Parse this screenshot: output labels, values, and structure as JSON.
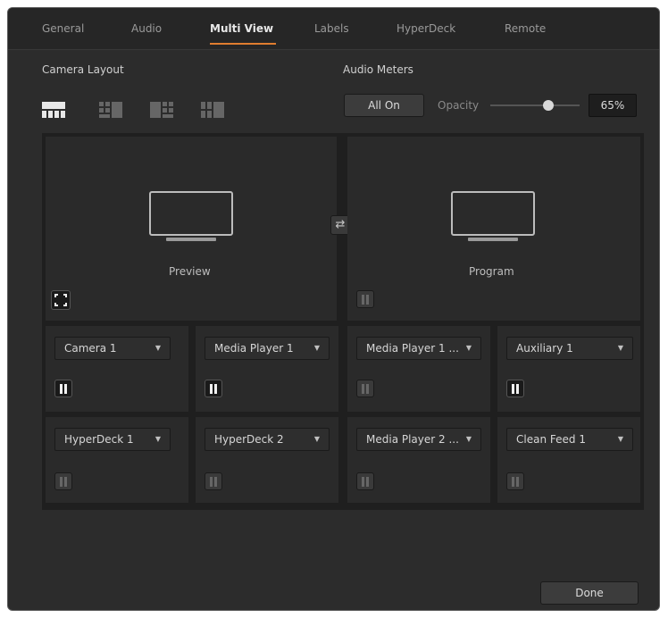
{
  "tabs": [
    "General",
    "Audio",
    "Multi View",
    "Labels",
    "HyperDeck",
    "Remote"
  ],
  "active_tab": "Multi View",
  "accent_color": "#e07d2f",
  "camera_layout": {
    "label": "Camera Layout",
    "options": [
      "layout-1",
      "layout-2",
      "layout-3",
      "layout-4"
    ],
    "selected_index": 0
  },
  "audio_meters": {
    "label": "Audio Meters",
    "all_on_label": "All On",
    "opacity_label": "Opacity",
    "opacity_value": "65%",
    "opacity_level": 0.65
  },
  "preview": {
    "label": "Preview",
    "icon": "safe-area-icon"
  },
  "program": {
    "label": "Program",
    "icon": "audio-meter-icon"
  },
  "swap_icon": "swap-icon",
  "windows": [
    {
      "source": "Camera 1",
      "meter_on": true
    },
    {
      "source": "Media Player 1",
      "meter_on": true
    },
    {
      "source": "Media Player 1 ...",
      "meter_on": false
    },
    {
      "source": "Auxiliary 1",
      "meter_on": true
    },
    {
      "source": "HyperDeck 1",
      "meter_on": false
    },
    {
      "source": "HyperDeck 2",
      "meter_on": false
    },
    {
      "source": "Media Player 2 ...",
      "meter_on": false
    },
    {
      "source": "Clean Feed 1",
      "meter_on": false
    }
  ],
  "done_label": "Done"
}
